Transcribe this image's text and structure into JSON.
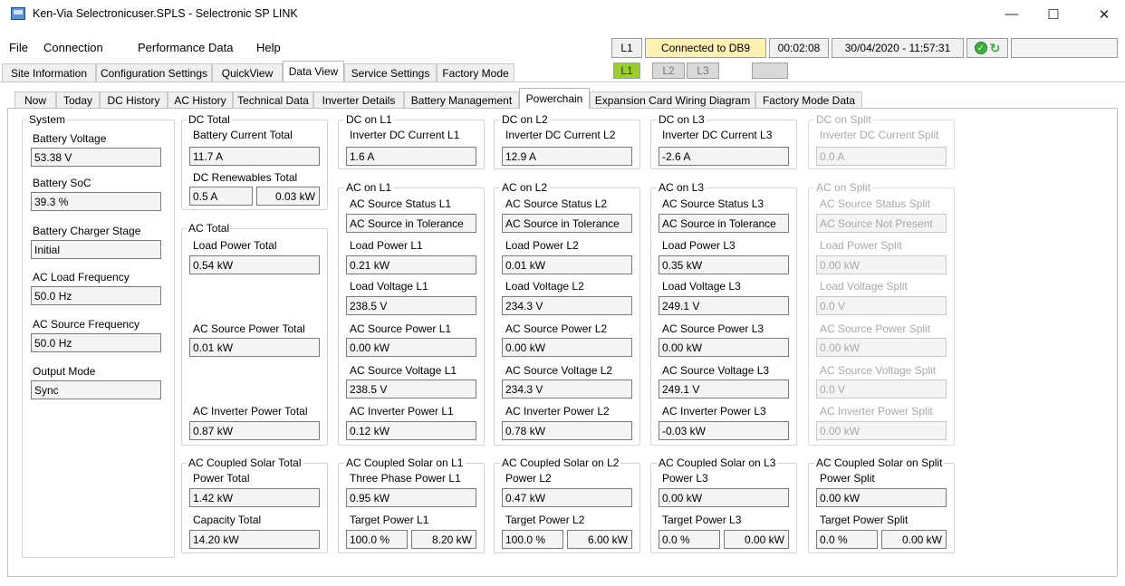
{
  "window": {
    "title": "Ken-Via Selectronicuser.SPLS - Selectronic SP LINK",
    "minimize": "—",
    "maximize": "☐",
    "close": "✕"
  },
  "menu": [
    "File",
    "Connection",
    "Performance Data",
    "Help"
  ],
  "status": {
    "line": "L1",
    "connection": "Connected to DB9",
    "elapsed": "00:02:08",
    "datetime": "30/04/2020 - 11:57:31",
    "connection_color": "#fff0b3",
    "ok_icon": "check-circle-icon",
    "refresh_icon": "refresh-icon"
  },
  "tabs": [
    "Site Information",
    "Configuration Settings",
    "QuickView",
    "Data View",
    "Service Settings",
    "Factory Mode"
  ],
  "active_tab": "Data View",
  "phases": [
    "L1",
    "L2",
    "L3"
  ],
  "active_phase_color": "#9acd32",
  "subtabs": [
    "Now",
    "Today",
    "DC History",
    "AC History",
    "Technical Data",
    "Inverter Details",
    "Battery Management",
    "Powerchain",
    "Expansion Card Wiring Diagram",
    "Factory Mode Data"
  ],
  "active_subtab": "Powerchain",
  "system": {
    "title": "System",
    "battery_voltage": {
      "label": "Battery Voltage",
      "value": "53.38 V"
    },
    "battery_soc": {
      "label": "Battery SoC",
      "value": "39.3 %"
    },
    "charger_stage": {
      "label": "Battery Charger Stage",
      "value": "Initial"
    },
    "load_frequency": {
      "label": "AC Load Frequency",
      "value": "50.0 Hz"
    },
    "source_frequency": {
      "label": "AC Source Frequency",
      "value": "50.0 Hz"
    },
    "output_mode": {
      "label": "Output Mode",
      "value": "Sync"
    }
  },
  "dc_total": {
    "title": "DC Total",
    "battery_current": {
      "label": "Battery Current Total",
      "value": "11.7 A"
    },
    "renewables": {
      "label": "DC Renewables Total",
      "current": "0.5 A",
      "power": "0.03 kW"
    }
  },
  "ac_total": {
    "title": "AC Total",
    "load_power": {
      "label": "Load Power Total",
      "value": "0.54 kW"
    },
    "source_power": {
      "label": "AC Source Power Total",
      "value": "0.01 kW"
    },
    "inverter_power": {
      "label": "AC Inverter Power Total",
      "value": "0.87 kW"
    }
  },
  "dc_l1": {
    "title": "DC on L1",
    "label": "Inverter DC Current L1",
    "value": "1.6 A"
  },
  "dc_l2": {
    "title": "DC on L2",
    "label": "Inverter DC Current L2",
    "value": "12.9 A"
  },
  "dc_l3": {
    "title": "DC on L3",
    "label": "Inverter DC Current L3",
    "value": "-2.6 A"
  },
  "dc_split": {
    "title": "DC on Split",
    "label": "Inverter DC Current Split",
    "value": "0.0 A"
  },
  "ac_l1": {
    "title": "AC on L1",
    "source_status": {
      "label": "AC Source Status L1",
      "value": "AC Source in Tolerance"
    },
    "load_power": {
      "label": "Load Power L1",
      "value": "0.21 kW"
    },
    "load_voltage": {
      "label": "Load Voltage L1",
      "value": "238.5 V"
    },
    "source_power": {
      "label": "AC Source Power L1",
      "value": "0.00 kW"
    },
    "source_voltage": {
      "label": "AC Source Voltage L1",
      "value": "238.5 V"
    },
    "inverter_power": {
      "label": "AC Inverter Power L1",
      "value": "0.12 kW"
    }
  },
  "ac_l2": {
    "title": "AC on L2",
    "source_status": {
      "label": "AC Source Status L2",
      "value": "AC Source in Tolerance"
    },
    "load_power": {
      "label": "Load Power L2",
      "value": "0.01 kW"
    },
    "load_voltage": {
      "label": "Load Voltage L2",
      "value": "234.3 V"
    },
    "source_power": {
      "label": "AC Source Power L2",
      "value": "0.00 kW"
    },
    "source_voltage": {
      "label": "AC Source Voltage L2",
      "value": "234.3 V"
    },
    "inverter_power": {
      "label": "AC Inverter Power L2",
      "value": "0.78 kW"
    }
  },
  "ac_l3": {
    "title": "AC on L3",
    "source_status": {
      "label": "AC Source Status L3",
      "value": "AC Source in Tolerance"
    },
    "load_power": {
      "label": "Load Power L3",
      "value": "0.35 kW"
    },
    "load_voltage": {
      "label": "Load Voltage L3",
      "value": "249.1 V"
    },
    "source_power": {
      "label": "AC Source Power L3",
      "value": "0.00 kW"
    },
    "source_voltage": {
      "label": "AC Source Voltage L3",
      "value": "249.1 V"
    },
    "inverter_power": {
      "label": "AC Inverter Power L3",
      "value": "-0.03 kW"
    }
  },
  "ac_split": {
    "title": "AC on Split",
    "source_status": {
      "label": "AC Source Status Split",
      "value": "AC Source Not Present"
    },
    "load_power": {
      "label": "Load Power Split",
      "value": "0.00 kW"
    },
    "load_voltage": {
      "label": "Load Voltage Split",
      "value": "0.0 V"
    },
    "source_power": {
      "label": "AC Source Power Split",
      "value": "0.00 kW"
    },
    "source_voltage": {
      "label": "AC Source Voltage Split",
      "value": "0.0 V"
    },
    "inverter_power": {
      "label": "AC Inverter Power Split",
      "value": "0.00 kW"
    }
  },
  "solar_total": {
    "title": "AC Coupled Solar Total",
    "power": {
      "label": "Power Total",
      "value": "1.42 kW"
    },
    "capacity": {
      "label": "Capacity Total",
      "value": "14.20 kW"
    }
  },
  "solar_l1": {
    "title": "AC Coupled Solar on L1",
    "power_label": "Three Phase Power L1",
    "power": "0.95 kW",
    "target_label": "Target Power L1",
    "target_pct": "100.0 %",
    "target_kw": "8.20 kW"
  },
  "solar_l2": {
    "title": "AC Coupled Solar on L2",
    "power_label": "Power L2",
    "power": "0.47 kW",
    "target_label": "Target Power L2",
    "target_pct": "100.0 %",
    "target_kw": "6.00 kW"
  },
  "solar_l3": {
    "title": "AC Coupled Solar on L3",
    "power_label": "Power L3",
    "power": "0.00 kW",
    "target_label": "Target Power L3",
    "target_pct": "0.0 %",
    "target_kw": "0.00 kW"
  },
  "solar_split": {
    "title": "AC Coupled Solar on Split",
    "power_label": "Power Split",
    "power": "0.00 kW",
    "target_label": "Target Power Split",
    "target_pct": "0.0 %",
    "target_kw": "0.00 kW"
  }
}
